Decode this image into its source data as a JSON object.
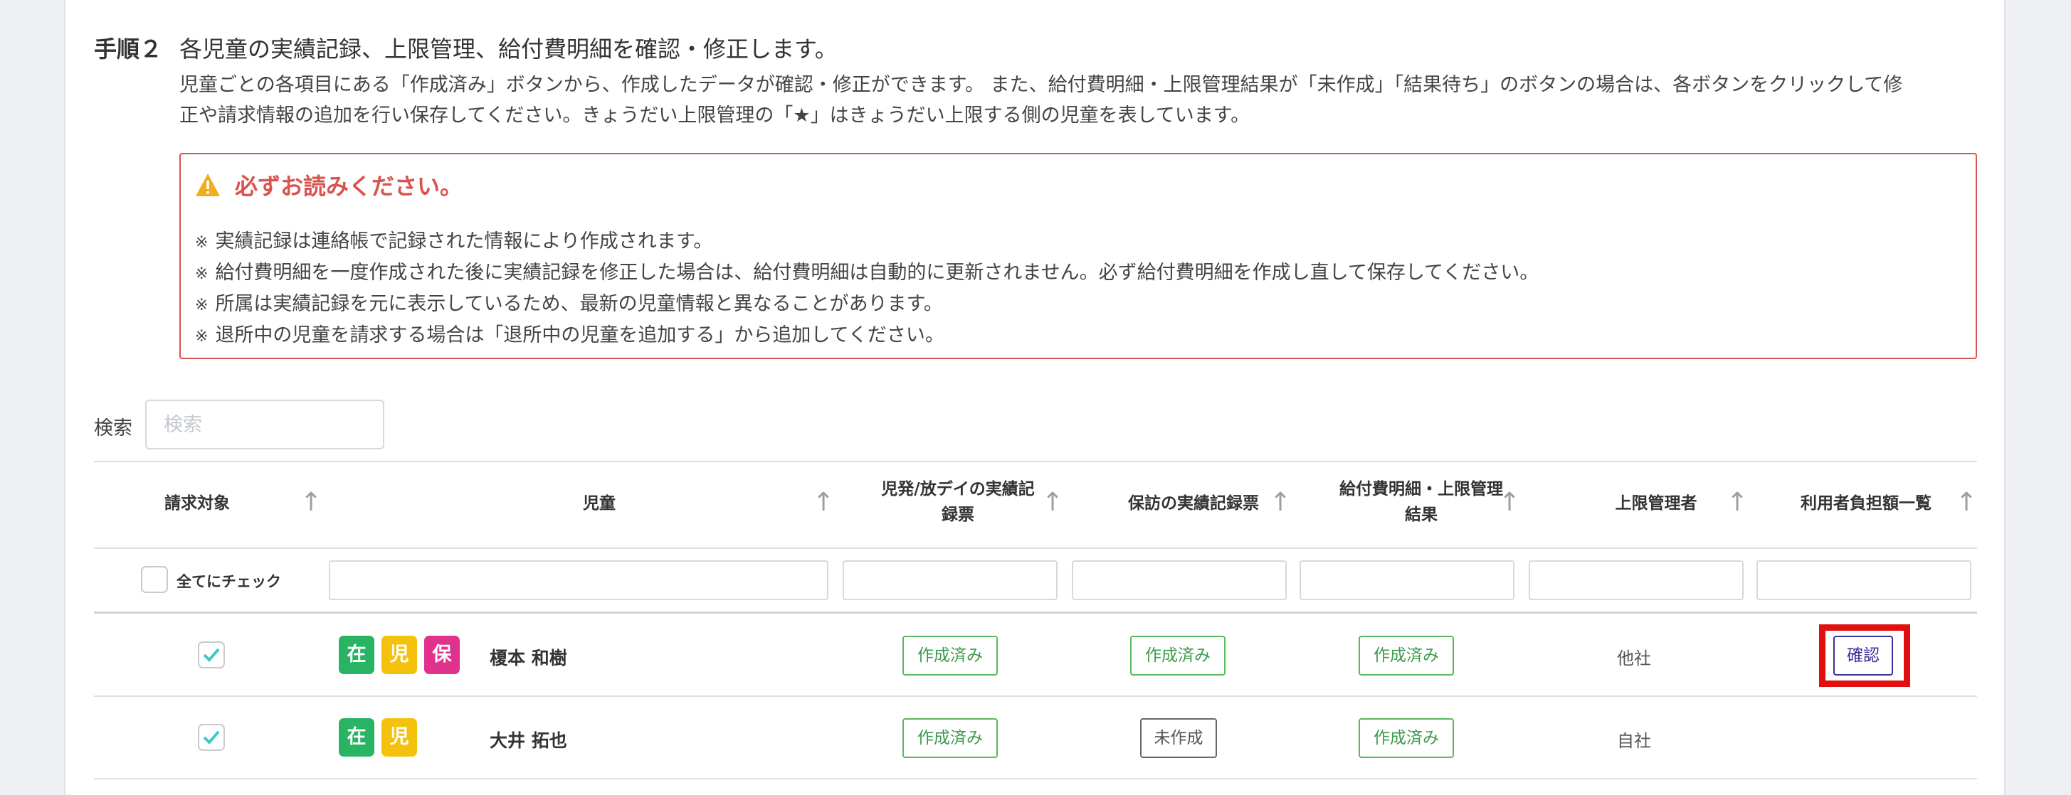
{
  "step": {
    "label": "手順２",
    "title": "各児童の実績記録、上限管理、給付費明細を確認・修正します。",
    "desc_line1": "児童ごとの各項目にある「作成済み」ボタンから、作成したデータが確認・修正ができます。 また、給付費明細・上限管理結果が「未作成」「結果待ち」のボタンの場合は、各ボタンをクリックして修",
    "desc_line2": "正や請求情報の追加を行い保存してください。きょうだい上限管理の「★」はきょうだい上限する側の児童を表しています。"
  },
  "notice": {
    "title": "必ずお読みください。",
    "mark": "※",
    "items": [
      "実績記録は連絡帳で記録された情報により作成されます。",
      "給付費明細を一度作成された後に実績記録を修正した場合は、給付費明細は自動的に更新されません。必ず給付費明細を作成し直して保存してください。",
      "所属は実績記録を元に表示しているため、最新の児童情報と異なることがあります。",
      "退所中の児童を請求する場合は「退所中の児童を追加する」から追加してください。"
    ]
  },
  "search": {
    "label": "検索",
    "placeholder": "検索",
    "value": ""
  },
  "table": {
    "sort_glyph": "↑",
    "headers": {
      "target": "請求対象",
      "child": "児童",
      "jihatsu_l1": "児発/放デイの実績記",
      "jihatsu_l2": "録票",
      "hoho": "保訪の実績記録票",
      "kyufu_l1": "給付費明細・上限管理",
      "kyufu_l2": "結果",
      "manager": "上限管理者",
      "burden": "利用者負担額一覧"
    },
    "check_all_label": "全てにチェック",
    "rows": [
      {
        "checked": true,
        "badges": [
          "在",
          "児",
          "保"
        ],
        "name": "榎本 和樹",
        "jihatsu": "作成済み",
        "hoho": "作成済み",
        "kyufu": "作成済み",
        "manager": "他社",
        "burden": "確認"
      },
      {
        "checked": true,
        "badges": [
          "在",
          "児"
        ],
        "name": "大井 拓也",
        "jihatsu": "作成済み",
        "hoho": "未作成",
        "kyufu": "作成済み",
        "manager": "自社",
        "burden": ""
      }
    ]
  },
  "colors": {
    "badge_zai": "#28b463",
    "badge_ji": "#f4c20d",
    "badge_ho": "#e0318c",
    "done_border": "#5cb85c",
    "notice_red": "#d9534f",
    "highlight": "#e01010"
  },
  "icons": {
    "notice": "warning-triangle-icon",
    "checkbox_checked": "check-icon"
  }
}
